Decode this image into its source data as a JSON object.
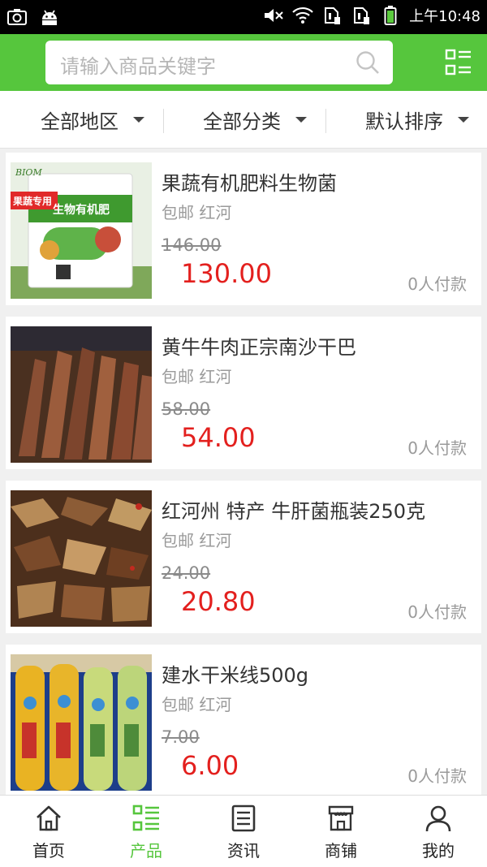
{
  "status_bar": {
    "time": "上午10:48"
  },
  "search": {
    "placeholder": "请输入商品关键字"
  },
  "filters": [
    {
      "label": "全部地区"
    },
    {
      "label": "全部分类"
    },
    {
      "label": "默认排序"
    }
  ],
  "products": [
    {
      "title": "果蔬有机肥料生物菌",
      "location": "包邮 红河",
      "old_price": "146.00",
      "price": "130.00",
      "paid": "0人付款",
      "image_text_brand": "BIOM",
      "image_text_tag": "果蔬专用",
      "image_text_name": "生物有机肥"
    },
    {
      "title": "黄牛牛肉正宗南沙干巴",
      "location": "包邮 红河",
      "old_price": "58.00",
      "price": "54.00",
      "paid": "0人付款"
    },
    {
      "title": "红河州 特产 牛肝菌瓶装250克",
      "location": "包邮 红河",
      "old_price": "24.00",
      "price": "20.80",
      "paid": "0人付款"
    },
    {
      "title": "建水干米线500g",
      "location": "包邮 红河",
      "old_price": "7.00",
      "price": "6.00",
      "paid": "0人付款"
    }
  ],
  "tabs": [
    {
      "label": "首页",
      "icon": "home-icon"
    },
    {
      "label": "产品",
      "icon": "products-icon"
    },
    {
      "label": "资讯",
      "icon": "news-icon"
    },
    {
      "label": "商铺",
      "icon": "store-icon"
    },
    {
      "label": "我的",
      "icon": "user-icon"
    }
  ],
  "colors": {
    "accent": "#56c63d",
    "price": "#e3201e"
  }
}
